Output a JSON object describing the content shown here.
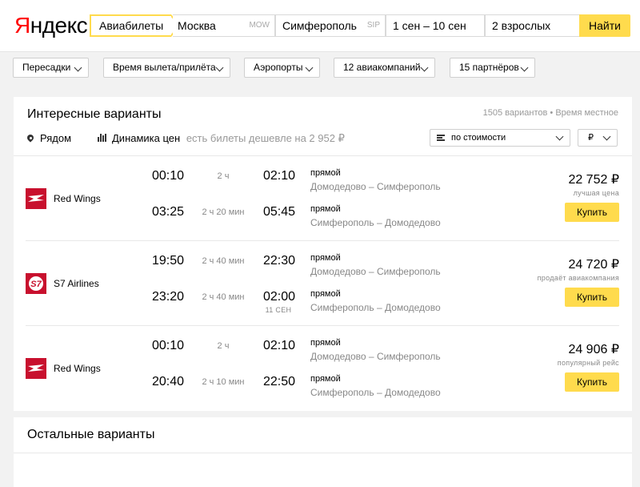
{
  "header": {
    "logo_first": "Я",
    "logo_rest": "ндекс",
    "mode_tab": "Авиабилеты",
    "from": {
      "value": "Москва",
      "code": "MOW"
    },
    "to": {
      "value": "Симферополь",
      "code": "SIP"
    },
    "dates": "1 сен – 10 сен",
    "passengers": "2 взрослых",
    "find_button": "Найти"
  },
  "filters": [
    {
      "label": "Пересадки"
    },
    {
      "label": "Время вылета/прилёта"
    },
    {
      "label": "Аэропорты"
    },
    {
      "label": "12 авиакомпаний"
    },
    {
      "label": "15 партнёров"
    }
  ],
  "main": {
    "title": "Интересные варианты",
    "meta": "1505 вариантов  •  Время местное",
    "near_label": "Рядом",
    "dynamics_label": "Динамика цен",
    "cheaper_note": "есть билеты дешевле на 2 952 ₽",
    "sort_value": "по стоимости",
    "currency_value": "₽"
  },
  "offers": [
    {
      "airline": "Red Wings",
      "logo": "red-wings-logo",
      "price": "22 752 ₽",
      "price_note": "лучшая цена",
      "buy_label": "Купить",
      "legs": [
        {
          "dep": "00:10",
          "duration": "2 ч",
          "arr": "02:10",
          "next_day": "",
          "type": "прямой",
          "route": "Домодедово – Симферополь"
        },
        {
          "dep": "03:25",
          "duration": "2 ч 20 мин",
          "arr": "05:45",
          "next_day": "",
          "type": "прямой",
          "route": "Симферополь – Домодедово"
        }
      ]
    },
    {
      "airline": "S7 Airlines",
      "logo": "s7-logo",
      "price": "24 720 ₽",
      "price_note": "продаёт авиакомпания",
      "buy_label": "Купить",
      "legs": [
        {
          "dep": "19:50",
          "duration": "2 ч 40 мин",
          "arr": "22:30",
          "next_day": "",
          "type": "прямой",
          "route": "Домодедово – Симферополь"
        },
        {
          "dep": "23:20",
          "duration": "2 ч 40 мин",
          "arr": "02:00",
          "next_day": "11 СЕН",
          "type": "прямой",
          "route": "Симферополь – Домодедово"
        }
      ]
    },
    {
      "airline": "Red Wings",
      "logo": "red-wings-logo",
      "price": "24 906 ₽",
      "price_note": "популярный рейс",
      "buy_label": "Купить",
      "legs": [
        {
          "dep": "00:10",
          "duration": "2 ч",
          "arr": "02:10",
          "next_day": "",
          "type": "прямой",
          "route": "Домодедово – Симферополь"
        },
        {
          "dep": "20:40",
          "duration": "2 ч 10 мин",
          "arr": "22:50",
          "next_day": "",
          "type": "прямой",
          "route": "Симферополь – Домодедово"
        }
      ]
    }
  ],
  "other": {
    "title": "Остальные варианты"
  },
  "colors": {
    "accent": "#ffdb4d",
    "brand_red": "#ff0000",
    "airline_red": "#c8102e"
  }
}
